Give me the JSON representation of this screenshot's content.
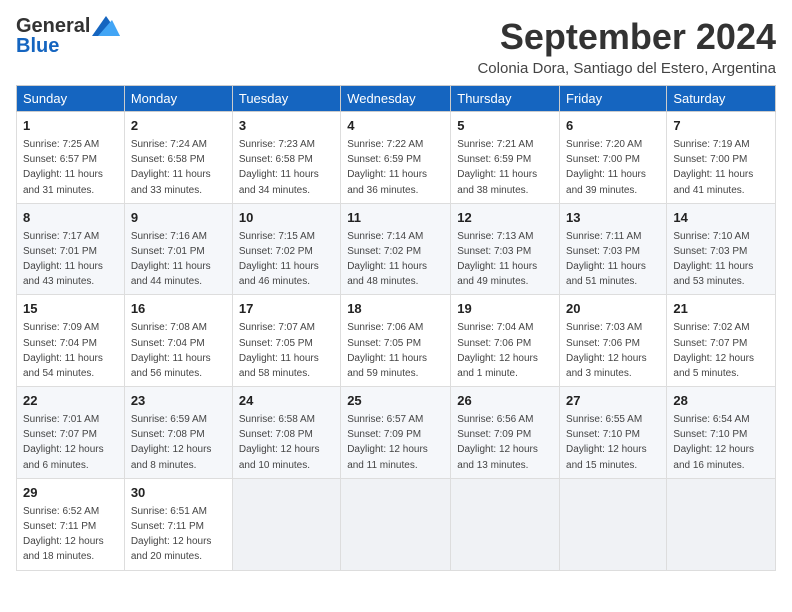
{
  "logo": {
    "general": "General",
    "blue": "Blue"
  },
  "title": "September 2024",
  "subtitle": "Colonia Dora, Santiago del Estero, Argentina",
  "weekdays": [
    "Sunday",
    "Monday",
    "Tuesday",
    "Wednesday",
    "Thursday",
    "Friday",
    "Saturday"
  ],
  "weeks": [
    [
      {
        "day": 1,
        "sunrise": "7:25 AM",
        "sunset": "6:57 PM",
        "daylight": "11 hours and 31 minutes."
      },
      {
        "day": 2,
        "sunrise": "7:24 AM",
        "sunset": "6:58 PM",
        "daylight": "11 hours and 33 minutes."
      },
      {
        "day": 3,
        "sunrise": "7:23 AM",
        "sunset": "6:58 PM",
        "daylight": "11 hours and 34 minutes."
      },
      {
        "day": 4,
        "sunrise": "7:22 AM",
        "sunset": "6:59 PM",
        "daylight": "11 hours and 36 minutes."
      },
      {
        "day": 5,
        "sunrise": "7:21 AM",
        "sunset": "6:59 PM",
        "daylight": "11 hours and 38 minutes."
      },
      {
        "day": 6,
        "sunrise": "7:20 AM",
        "sunset": "7:00 PM",
        "daylight": "11 hours and 39 minutes."
      },
      {
        "day": 7,
        "sunrise": "7:19 AM",
        "sunset": "7:00 PM",
        "daylight": "11 hours and 41 minutes."
      }
    ],
    [
      {
        "day": 8,
        "sunrise": "7:17 AM",
        "sunset": "7:01 PM",
        "daylight": "11 hours and 43 minutes."
      },
      {
        "day": 9,
        "sunrise": "7:16 AM",
        "sunset": "7:01 PM",
        "daylight": "11 hours and 44 minutes."
      },
      {
        "day": 10,
        "sunrise": "7:15 AM",
        "sunset": "7:02 PM",
        "daylight": "11 hours and 46 minutes."
      },
      {
        "day": 11,
        "sunrise": "7:14 AM",
        "sunset": "7:02 PM",
        "daylight": "11 hours and 48 minutes."
      },
      {
        "day": 12,
        "sunrise": "7:13 AM",
        "sunset": "7:03 PM",
        "daylight": "11 hours and 49 minutes."
      },
      {
        "day": 13,
        "sunrise": "7:11 AM",
        "sunset": "7:03 PM",
        "daylight": "11 hours and 51 minutes."
      },
      {
        "day": 14,
        "sunrise": "7:10 AM",
        "sunset": "7:03 PM",
        "daylight": "11 hours and 53 minutes."
      }
    ],
    [
      {
        "day": 15,
        "sunrise": "7:09 AM",
        "sunset": "7:04 PM",
        "daylight": "11 hours and 54 minutes."
      },
      {
        "day": 16,
        "sunrise": "7:08 AM",
        "sunset": "7:04 PM",
        "daylight": "11 hours and 56 minutes."
      },
      {
        "day": 17,
        "sunrise": "7:07 AM",
        "sunset": "7:05 PM",
        "daylight": "11 hours and 58 minutes."
      },
      {
        "day": 18,
        "sunrise": "7:06 AM",
        "sunset": "7:05 PM",
        "daylight": "11 hours and 59 minutes."
      },
      {
        "day": 19,
        "sunrise": "7:04 AM",
        "sunset": "7:06 PM",
        "daylight": "12 hours and 1 minute."
      },
      {
        "day": 20,
        "sunrise": "7:03 AM",
        "sunset": "7:06 PM",
        "daylight": "12 hours and 3 minutes."
      },
      {
        "day": 21,
        "sunrise": "7:02 AM",
        "sunset": "7:07 PM",
        "daylight": "12 hours and 5 minutes."
      }
    ],
    [
      {
        "day": 22,
        "sunrise": "7:01 AM",
        "sunset": "7:07 PM",
        "daylight": "12 hours and 6 minutes."
      },
      {
        "day": 23,
        "sunrise": "6:59 AM",
        "sunset": "7:08 PM",
        "daylight": "12 hours and 8 minutes."
      },
      {
        "day": 24,
        "sunrise": "6:58 AM",
        "sunset": "7:08 PM",
        "daylight": "12 hours and 10 minutes."
      },
      {
        "day": 25,
        "sunrise": "6:57 AM",
        "sunset": "7:09 PM",
        "daylight": "12 hours and 11 minutes."
      },
      {
        "day": 26,
        "sunrise": "6:56 AM",
        "sunset": "7:09 PM",
        "daylight": "12 hours and 13 minutes."
      },
      {
        "day": 27,
        "sunrise": "6:55 AM",
        "sunset": "7:10 PM",
        "daylight": "12 hours and 15 minutes."
      },
      {
        "day": 28,
        "sunrise": "6:54 AM",
        "sunset": "7:10 PM",
        "daylight": "12 hours and 16 minutes."
      }
    ],
    [
      {
        "day": 29,
        "sunrise": "6:52 AM",
        "sunset": "7:11 PM",
        "daylight": "12 hours and 18 minutes."
      },
      {
        "day": 30,
        "sunrise": "6:51 AM",
        "sunset": "7:11 PM",
        "daylight": "12 hours and 20 minutes."
      },
      null,
      null,
      null,
      null,
      null
    ]
  ]
}
